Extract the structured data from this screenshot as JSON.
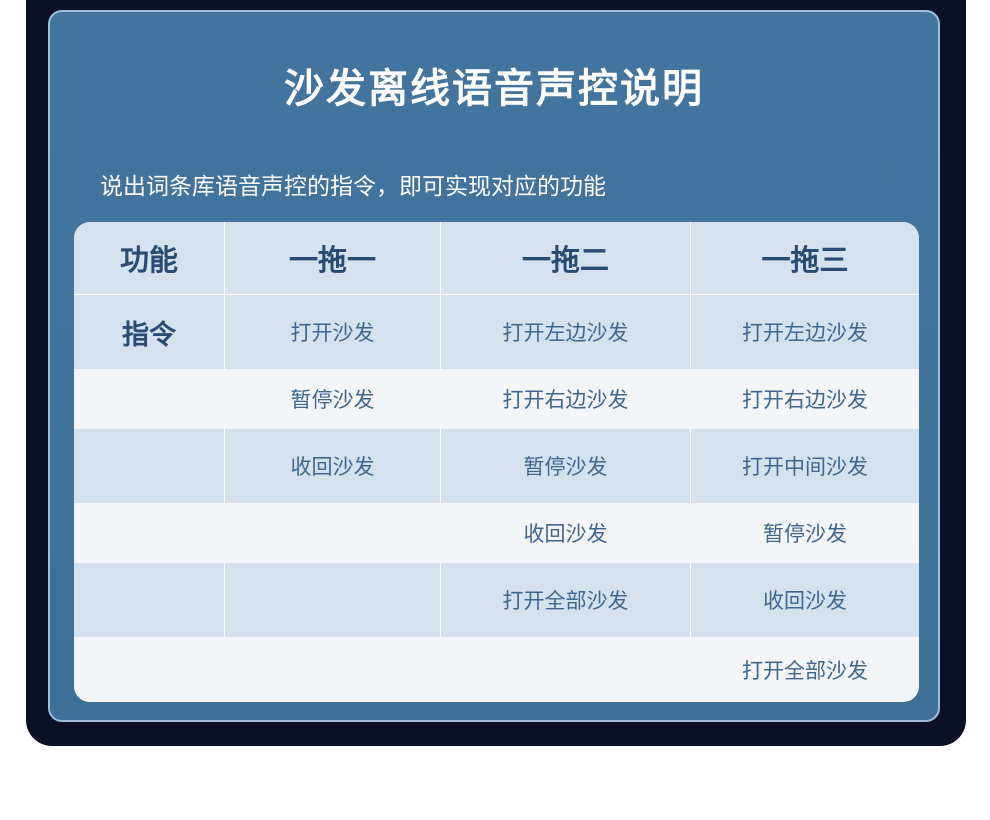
{
  "title": "沙发离线语音声控说明",
  "subtitle": "说出词条库语音声控的指令，即可实现对应的功能",
  "table": {
    "header": [
      "功能",
      "一拖一",
      "一拖二",
      "一拖三"
    ],
    "row_label": "指令",
    "rows": [
      [
        "",
        "打开沙发",
        "打开左边沙发",
        "打开左边沙发"
      ],
      [
        "",
        "暂停沙发",
        "打开右边沙发",
        "打开右边沙发"
      ],
      [
        "",
        "收回沙发",
        "暂停沙发",
        "打开中间沙发"
      ],
      [
        "",
        "",
        "收回沙发",
        "暂停沙发"
      ],
      [
        "",
        "",
        "打开全部沙发",
        "收回沙发"
      ],
      [
        "",
        "",
        "",
        "打开全部沙发"
      ]
    ]
  },
  "colors": {
    "outer_background": "#0b1026",
    "panel_background": "#43749e",
    "panel_border": "#9cc0dc",
    "row_dark": "#d4e1ee",
    "row_light": "#f3f5f9",
    "header_text": "#294a72",
    "cell_text": "#3f668f"
  }
}
